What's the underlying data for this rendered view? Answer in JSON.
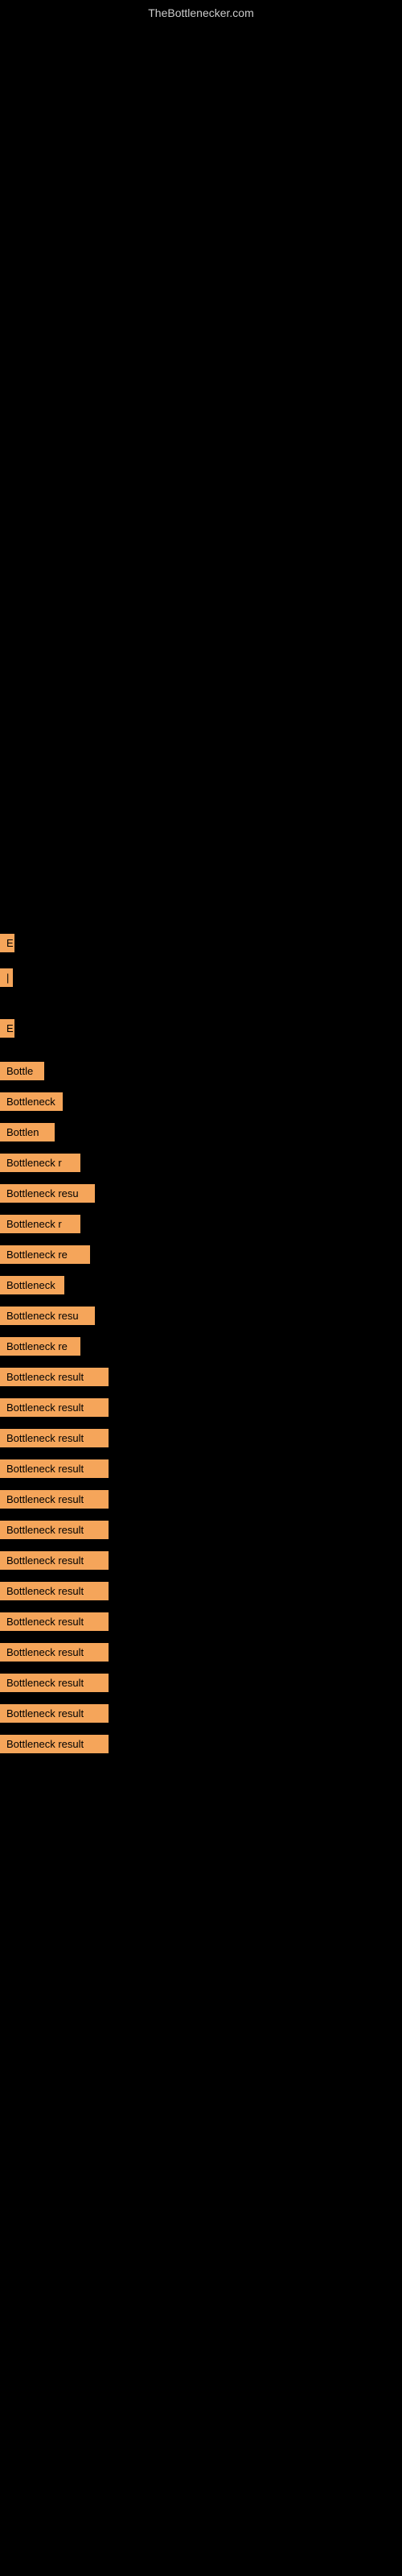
{
  "site": {
    "title": "TheBottlenecker.com"
  },
  "items": [
    {
      "id": 1,
      "label": "E",
      "size_class": "item-small"
    },
    {
      "id": 2,
      "label": "|",
      "size_class": "item-pipe"
    },
    {
      "id": 3,
      "label": "E",
      "size_class": "item-e2"
    },
    {
      "id": 4,
      "label": "Bottle",
      "size_class": "item-bottle-short"
    },
    {
      "id": 5,
      "label": "Bottleneck",
      "size_class": "item-bottleneck-med"
    },
    {
      "id": 6,
      "label": "Bottlen",
      "size_class": "item-bottlen-med"
    },
    {
      "id": 7,
      "label": "Bottleneck r",
      "size_class": "item-bottleneck-r1"
    },
    {
      "id": 8,
      "label": "Bottleneck resu",
      "size_class": "item-bottleneck-res1"
    },
    {
      "id": 9,
      "label": "Bottleneck r",
      "size_class": "item-bottleneck-r2"
    },
    {
      "id": 10,
      "label": "Bottleneck re",
      "size_class": "item-bottleneck-re2"
    },
    {
      "id": 11,
      "label": "Bottleneck",
      "size_class": "item-bottleneck-c"
    },
    {
      "id": 12,
      "label": "Bottleneck resu",
      "size_class": "item-bottleneck-res2"
    },
    {
      "id": 13,
      "label": "Bottleneck re",
      "size_class": "item-bottleneck-r3"
    },
    {
      "id": 14,
      "label": "Bottleneck result",
      "size_class": "item-bottleneck-result-full"
    },
    {
      "id": 15,
      "label": "Bottleneck result",
      "size_class": "items-regular"
    },
    {
      "id": 16,
      "label": "Bottleneck result",
      "size_class": "items-regular"
    },
    {
      "id": 17,
      "label": "Bottleneck result",
      "size_class": "items-regular"
    },
    {
      "id": 18,
      "label": "Bottleneck result",
      "size_class": "items-regular"
    },
    {
      "id": 19,
      "label": "Bottleneck result",
      "size_class": "items-regular"
    },
    {
      "id": 20,
      "label": "Bottleneck result",
      "size_class": "items-regular"
    },
    {
      "id": 21,
      "label": "Bottleneck result",
      "size_class": "items-regular"
    },
    {
      "id": 22,
      "label": "Bottleneck result",
      "size_class": "items-regular"
    },
    {
      "id": 23,
      "label": "Bottleneck result",
      "size_class": "items-regular"
    },
    {
      "id": 24,
      "label": "Bottleneck result",
      "size_class": "items-regular"
    },
    {
      "id": 25,
      "label": "Bottleneck result",
      "size_class": "items-regular"
    },
    {
      "id": 26,
      "label": "Bottleneck result",
      "size_class": "items-regular"
    }
  ]
}
